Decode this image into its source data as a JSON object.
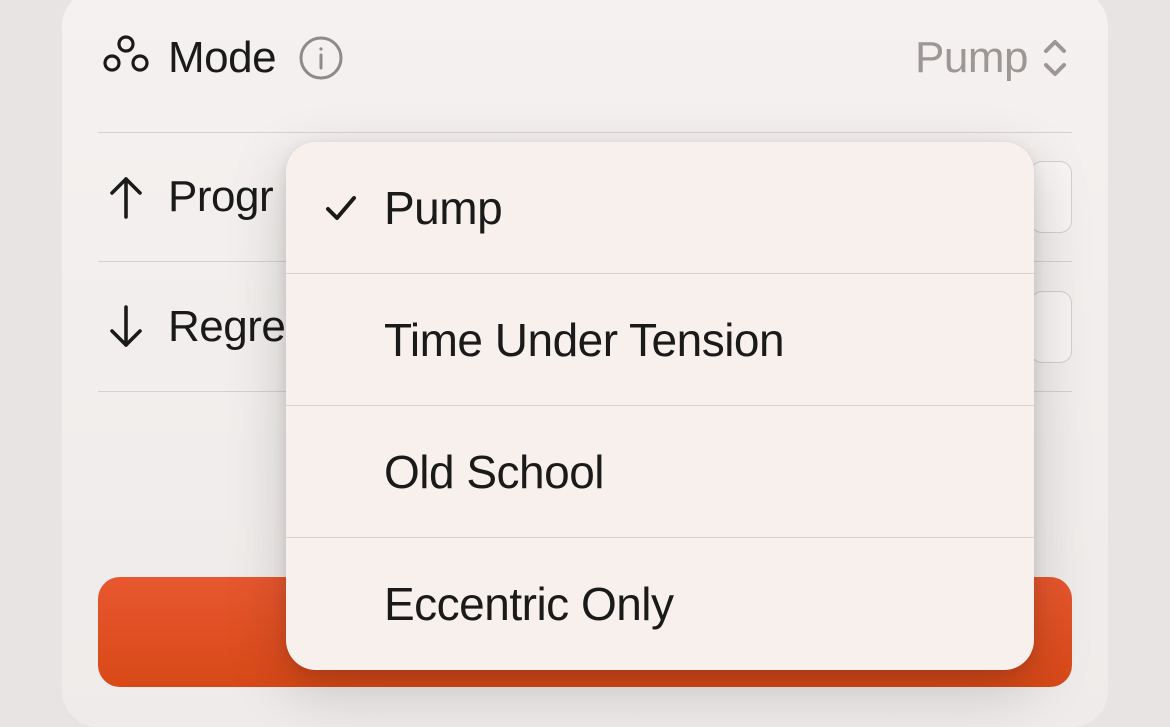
{
  "settings": {
    "mode_label": "Mode",
    "mode_value": "Pump",
    "progression_label": "Progr",
    "regression_label": "Regre"
  },
  "popover": {
    "items": [
      {
        "label": "Pump",
        "selected": true
      },
      {
        "label": "Time Under Tension",
        "selected": false
      },
      {
        "label": "Old School",
        "selected": false
      },
      {
        "label": "Eccentric Only",
        "selected": false
      }
    ]
  }
}
